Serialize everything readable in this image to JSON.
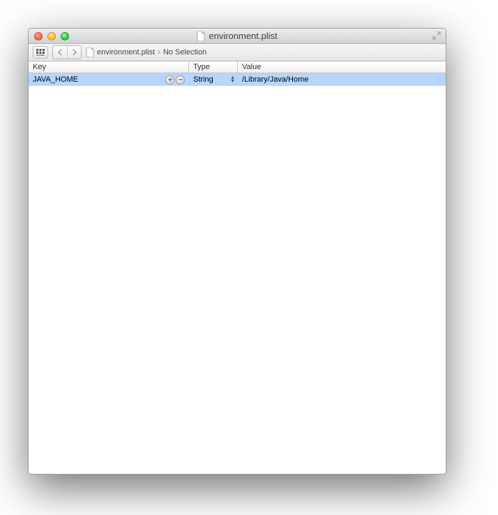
{
  "window": {
    "title": "environment.plist"
  },
  "toolbar": {
    "view_mode": "grid"
  },
  "breadcrumb": {
    "file": "environment.plist",
    "selection": "No Selection"
  },
  "table": {
    "headers": {
      "key": "Key",
      "type": "Type",
      "value": "Value"
    },
    "rows": [
      {
        "key": "JAVA_HOME",
        "type": "String",
        "value": "/Library/Java/Home",
        "selected": true
      }
    ]
  }
}
